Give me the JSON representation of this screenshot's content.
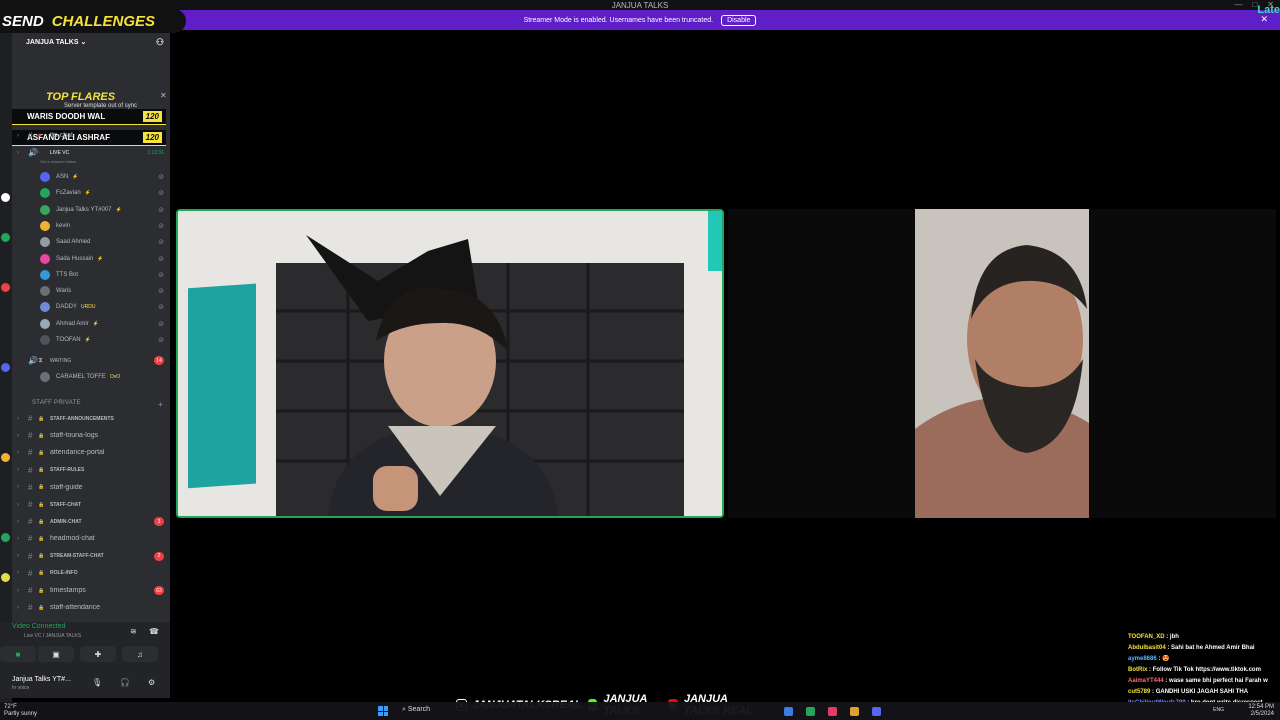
{
  "window": {
    "title": "JANJUA TALKS"
  },
  "streamer_banner": {
    "text": "Streamer Mode is enabled. Usernames have been truncated.",
    "button": "Disable"
  },
  "late_label": "Late",
  "overlay": {
    "send": "SEND",
    "challenges": "CHALLENGES"
  },
  "server": {
    "name": "JANJUA TALKS"
  },
  "flares": {
    "title": "TOP FLARES",
    "sync_note": "Server template out of sync",
    "rows": [
      {
        "name": "WARIS DOODH WAL",
        "score": "120"
      },
      {
        "name": "ASFAND ALI ASHRAF",
        "score": "120"
      }
    ]
  },
  "channels_top": [
    {
      "label": "tts-chat"
    }
  ],
  "live_vc": {
    "label": "LIVE VC",
    "time": "1:13:31",
    "status": "Set a channel status"
  },
  "voice_users": [
    {
      "name": "ASN",
      "tag": "⚡"
    },
    {
      "name": "FcZavian",
      "tag": "⚡"
    },
    {
      "name": "Janjua Talks YT#007",
      "tag": "⚡"
    },
    {
      "name": "kevin",
      "tag": ""
    },
    {
      "name": "Saad Ahmed",
      "tag": ""
    },
    {
      "name": "Sada Hussain",
      "tag": "⚡"
    },
    {
      "name": "TTS Bot",
      "tag": ""
    },
    {
      "name": "Waris",
      "tag": ""
    },
    {
      "name": "DADDY",
      "tag": "URDU"
    },
    {
      "name": "Ahmad Amir",
      "tag": "⚡"
    },
    {
      "name": "TOOFAN",
      "tag": "⚡"
    }
  ],
  "waiting": {
    "label": "WAITING",
    "badge": "14",
    "user": "CARAMEL TOFFE",
    "user_tag": "OvO"
  },
  "category_private": "STAFF PRIVATE",
  "staff_channels": [
    {
      "label": "STAFF-ANNOUNCEMENTS",
      "badge": ""
    },
    {
      "label": "staff-touna-logs",
      "badge": ""
    },
    {
      "label": "attendance-portal",
      "badge": ""
    },
    {
      "label": "STAFF-RULES",
      "badge": ""
    },
    {
      "label": "staff-guide",
      "badge": ""
    },
    {
      "label": "STAFF-CHAT",
      "badge": ""
    },
    {
      "label": "ADMIN-CHAT",
      "badge": "3"
    },
    {
      "label": "headmod-chat",
      "badge": ""
    },
    {
      "label": "STREAM-STAFF-CHAT",
      "badge": "2"
    },
    {
      "label": "ROLE-INFO",
      "badge": ""
    },
    {
      "label": "timestamps",
      "badge": "63"
    },
    {
      "label": "staff-attendance",
      "badge": ""
    }
  ],
  "voice_panel": {
    "connected": "Video Connected",
    "sub": "Live VC / JANJUA TALKS"
  },
  "user_panel": {
    "name": "Janjua Talks YT#...",
    "status": "In voice"
  },
  "chat": [
    {
      "user": "TOOFAN_XD",
      "text": "jbh",
      "color": "#f6e23c"
    },
    {
      "user": "Abdulbasit04",
      "text": "Sahi bat he Ahmed Amir Bhai",
      "color": "#f6e23c"
    },
    {
      "user": "ayme8686",
      "text": "😍",
      "color": "#5fb6ff"
    },
    {
      "user": "BotRix",
      "text": "Follow Tik Tok https://www.tiktok.com",
      "color": "#f6e23c"
    },
    {
      "user": "AaimaYT444",
      "text": "wase same bhi perfect hai Farah w",
      "color": "#ff6b6b"
    },
    {
      "user": "cut5789",
      "text": "GANDHI USKI JAGAH SAHI THA",
      "color": "#f6e23c"
    },
    {
      "user": "itsChilloutWoufs789",
      "text": "bro dont write disrespect",
      "color": "#7b8cff"
    }
  ],
  "socials": {
    "x": "JANJUATALKSREAL",
    "kick": "JANJUA TALKS",
    "youtube": "JANJUA TALKS REAL"
  },
  "taskbar": {
    "weather_temp": "72°F",
    "weather_desc": "Partly sunny",
    "search": "Search",
    "lang": "ENG",
    "time": "12:54 PM",
    "date": "2/5/2024"
  }
}
